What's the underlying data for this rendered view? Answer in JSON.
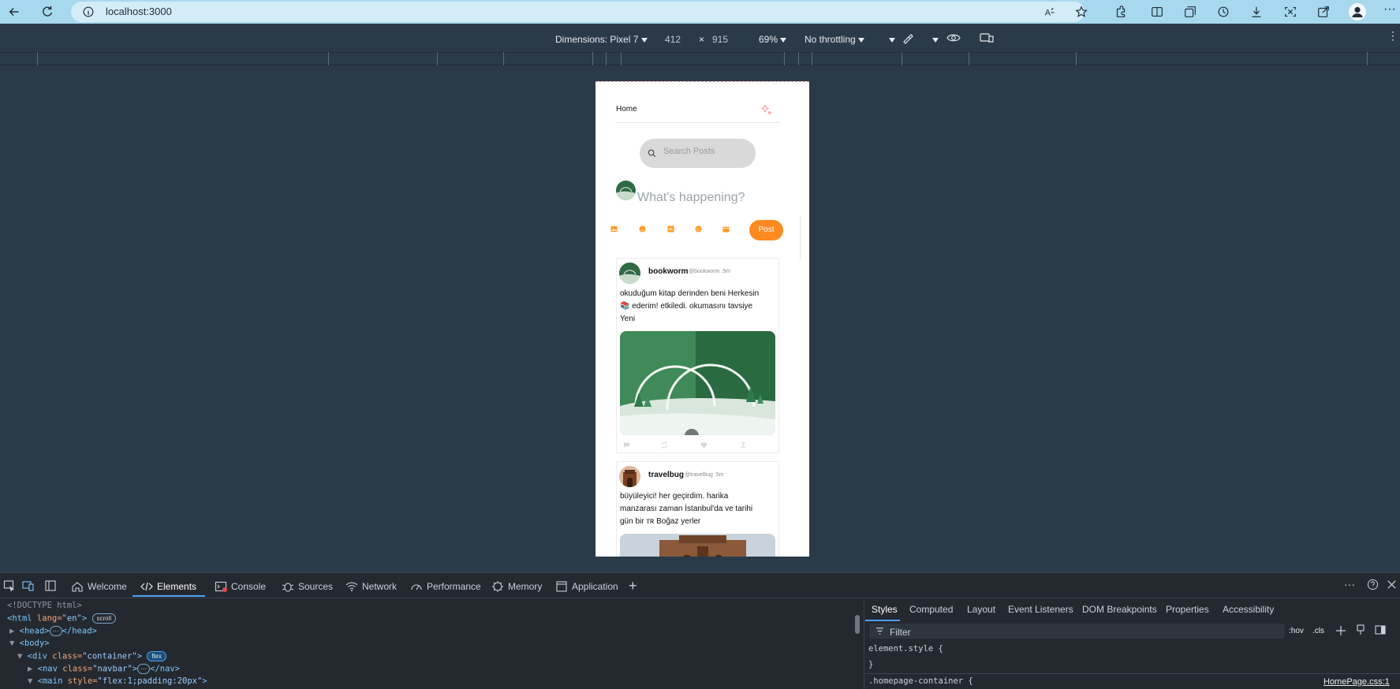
{
  "browser": {
    "url": "localhost:3000"
  },
  "device_toolbar": {
    "dimensions_label": "Dimensions: Pixel 7",
    "width": "412",
    "times": "×",
    "height": "915",
    "zoom": "69%",
    "throttling": "No throttling"
  },
  "app": {
    "nav_title": "Home",
    "search_placeholder": "Search Posts",
    "compose_placeholder": "What's happening?",
    "post_button": "Post",
    "posts": [
      {
        "username": "bookworm",
        "handle": "@bookworm .5m",
        "lines": [
          "okuduğum kitap derinden beni Herkesin",
          "📚 ederim! etkiledi. okumasını tavsiye",
          "Yeni"
        ]
      },
      {
        "username": "travelbug",
        "handle": "@travelbug .5m",
        "lines": [
          "büyüleyici! her geçirdim. harika",
          "manzarası zaman İstanbul'da ve tarihi",
          "gün bir ᴛʀ Boğaz yerler"
        ]
      }
    ]
  },
  "devtools": {
    "tabs": [
      "Welcome",
      "Elements",
      "Console",
      "Sources",
      "Network",
      "Performance",
      "Memory",
      "Application"
    ],
    "dom": {
      "doctype": "<!DOCTYPE html>",
      "html_open": "<html",
      "html_attr": " lang=",
      "html_val": "\"en\"",
      "html_close": ">",
      "scroll_badge": "scroll",
      "head": "<head>",
      "head_close": "</head>",
      "body": "<body>",
      "div_open": "<div",
      "div_attr": " class=",
      "div_val": "\"container\"",
      "div_close": ">",
      "flex_badge": "flex",
      "nav_open": "<nav",
      "nav_attr": " class=",
      "nav_val": "\"navbar\"",
      "nav_close": ">",
      "nav_end": "</nav>",
      "main_open": "<main",
      "main_attr": " style=",
      "main_val": "\"flex:1;padding:20px\"",
      "main_close": ">"
    },
    "styles_tabs": [
      "Styles",
      "Computed",
      "Layout",
      "Event Listeners",
      "DOM Breakpoints",
      "Properties",
      "Accessibility"
    ],
    "filter_placeholder": "Filter",
    "hov": ":hov",
    "cls": ".cls",
    "rule1": "element.style {",
    "rule1_end": "}",
    "rule2": ".homepage-container {",
    "rule2_source": "HomePage.css:1"
  },
  "colors": {
    "accent": "#ff8a1f",
    "devtools_bg": "#24292f",
    "page_bg": "#2b3a49",
    "browser_bar": "#a8d8ee"
  }
}
